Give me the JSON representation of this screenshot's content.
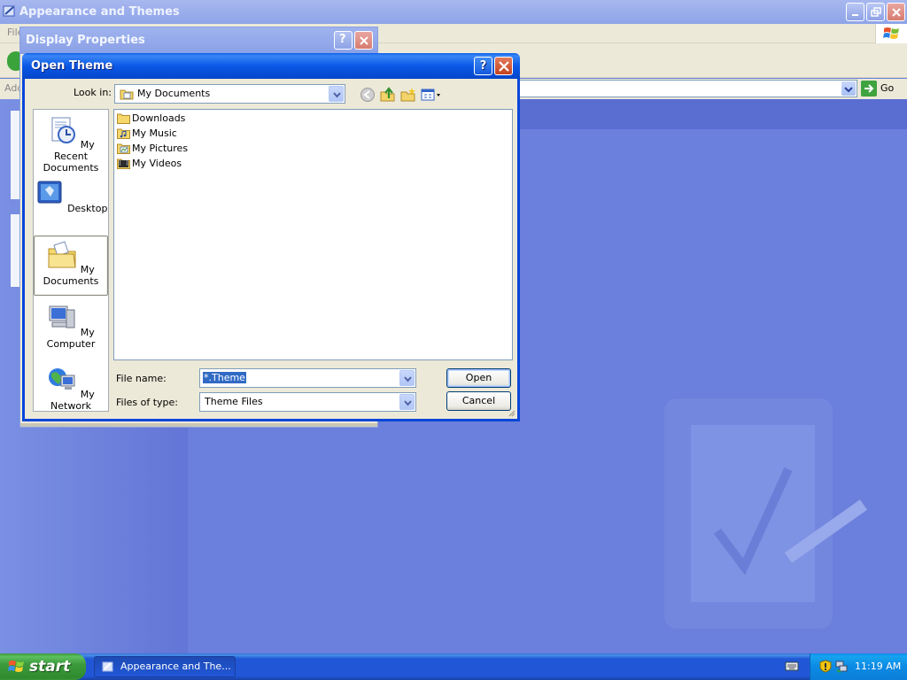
{
  "background_window": {
    "title": "Appearance and Themes",
    "menu_label": "File",
    "address_label": "Address",
    "go_label": "Go"
  },
  "display_properties": {
    "title": "Display Properties"
  },
  "dialog": {
    "title": "Open Theme",
    "help_label": "?",
    "look_in_label": "Look in:",
    "look_in_value": "My Documents",
    "places": [
      {
        "label": "My Recent Documents",
        "icon": "recent-documents-icon"
      },
      {
        "label": "Desktop",
        "icon": "desktop-icon"
      },
      {
        "label": "My Documents",
        "icon": "my-documents-icon"
      },
      {
        "label": "My Computer",
        "icon": "my-computer-icon"
      },
      {
        "label": "My Network",
        "icon": "my-network-icon"
      }
    ],
    "files": [
      {
        "name": "Downloads",
        "icon": "folder-icon"
      },
      {
        "name": "My Music",
        "icon": "music-folder-icon"
      },
      {
        "name": "My Pictures",
        "icon": "pictures-folder-icon"
      },
      {
        "name": "My Videos",
        "icon": "videos-folder-icon"
      }
    ],
    "file_name_label": "File name:",
    "file_name_value": "*.Theme",
    "files_of_type_label": "Files of type:",
    "files_of_type_value": "Theme Files",
    "open_label": "Open",
    "cancel_label": "Cancel"
  },
  "taskbar": {
    "start_label": "start",
    "task_label": "Appearance and The...",
    "clock": "11:19 AM"
  },
  "colors": {
    "title_blue": "#0a58e6",
    "desktop_blue": "#6b7fdc",
    "start_green": "#3d9b3d"
  }
}
